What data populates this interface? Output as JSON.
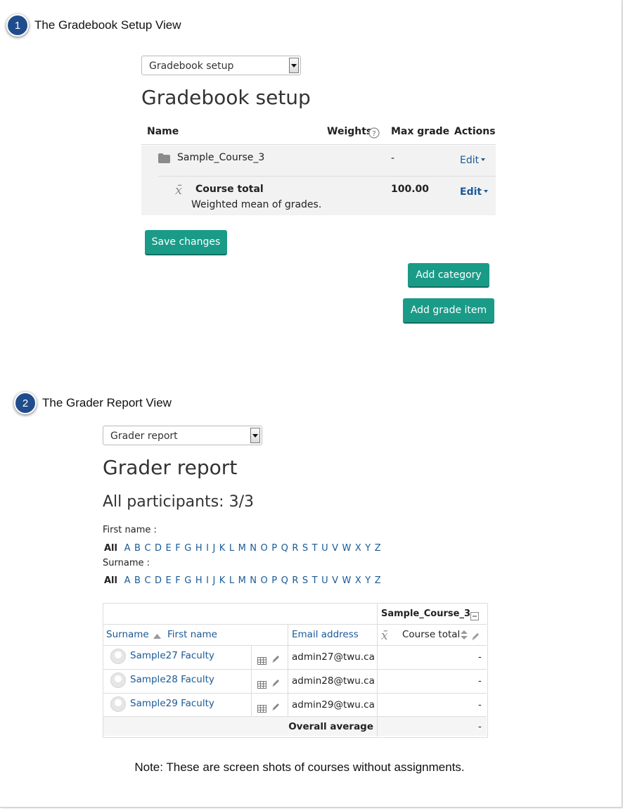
{
  "section1": {
    "number": "1",
    "title": "The Gradebook Setup View"
  },
  "setup": {
    "select_value": "Gradebook setup",
    "heading": "Gradebook setup",
    "columns": {
      "name": "Name",
      "weights": "Weights",
      "max_grade": "Max grade",
      "actions": "Actions"
    },
    "category_row": {
      "name": "Sample_Course_3",
      "max_grade": "-",
      "action": "Edit"
    },
    "total_row": {
      "name": "Course total",
      "desc": "Weighted mean of grades.",
      "max_grade": "100.00",
      "action": "Edit"
    },
    "save_button": "Save changes",
    "add_category_button": "Add category",
    "add_grade_item_button": "Add grade item"
  },
  "section2": {
    "number": "2",
    "title": "The Grader Report View"
  },
  "grader": {
    "select_value": "Grader report",
    "heading": "Grader report",
    "participants": "All participants: 3/3",
    "first_name_label": "First name :",
    "surname_label": "Surname :",
    "all_label": "All",
    "letters": [
      "A",
      "B",
      "C",
      "D",
      "E",
      "F",
      "G",
      "H",
      "I",
      "J",
      "K",
      "L",
      "M",
      "N",
      "O",
      "P",
      "Q",
      "R",
      "S",
      "T",
      "U",
      "V",
      "W",
      "X",
      "Y",
      "Z"
    ],
    "category_header": "Sample_Course_3",
    "col_surname": "Surname",
    "col_firstname": "First name",
    "col_email": "Email address",
    "col_course_total": "Course total",
    "rows": [
      {
        "name": "Sample27 Faculty",
        "email": "admin27@twu.ca",
        "total": "-"
      },
      {
        "name": "Sample28 Faculty",
        "email": "admin28@twu.ca",
        "total": "-"
      },
      {
        "name": "Sample29 Faculty",
        "email": "admin29@twu.ca",
        "total": "-"
      }
    ],
    "overall_label": "Overall average",
    "overall_value": "-"
  },
  "note": "Note: These are screen shots of courses without assignments.",
  "colors": {
    "button": "#1a9b88",
    "link": "#1a5a96",
    "badge": "#1f4c8c"
  }
}
